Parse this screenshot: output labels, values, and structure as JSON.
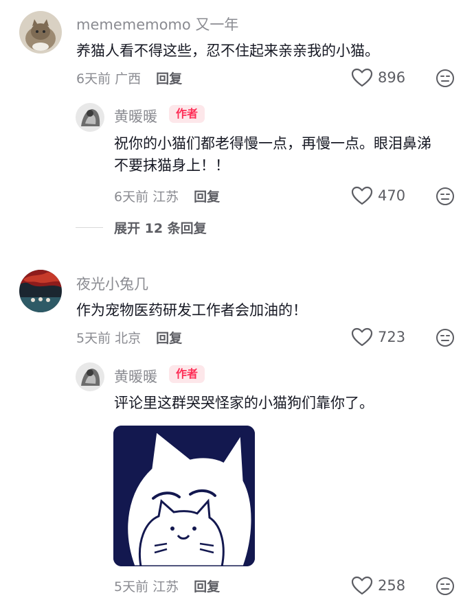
{
  "comments": [
    {
      "username": "memememomo 又一年",
      "text": "养猫人看不得这些，忍不住起来亲亲我的小猫。",
      "meta": "6天前 广西",
      "reply_label": "回复",
      "likes": "896"
    },
    {
      "username": "黄暖暖",
      "badge": "作者",
      "text": "祝你的小猫们都老得慢一点，再慢一点。眼泪鼻涕不要抹猫身上！！",
      "meta": "6天前 江苏",
      "reply_label": "回复",
      "likes": "470"
    },
    {
      "username": "夜光小兔几",
      "text": "作为宠物医药研发工作者会加油的！",
      "meta": "5天前 北京",
      "reply_label": "回复",
      "likes": "723"
    },
    {
      "username": "黄暖暖",
      "badge": "作者",
      "text": "评论里这群哭哭怪家的小猫狗们靠你了。",
      "meta": "5天前 江苏",
      "reply_label": "回复",
      "likes": "258"
    }
  ],
  "expand_replies": "展开 12 条回复",
  "colors": {
    "author_badge_bg": "#fde7ea",
    "author_badge_text": "#fe2c55",
    "sticker_bg": "#13184f"
  }
}
